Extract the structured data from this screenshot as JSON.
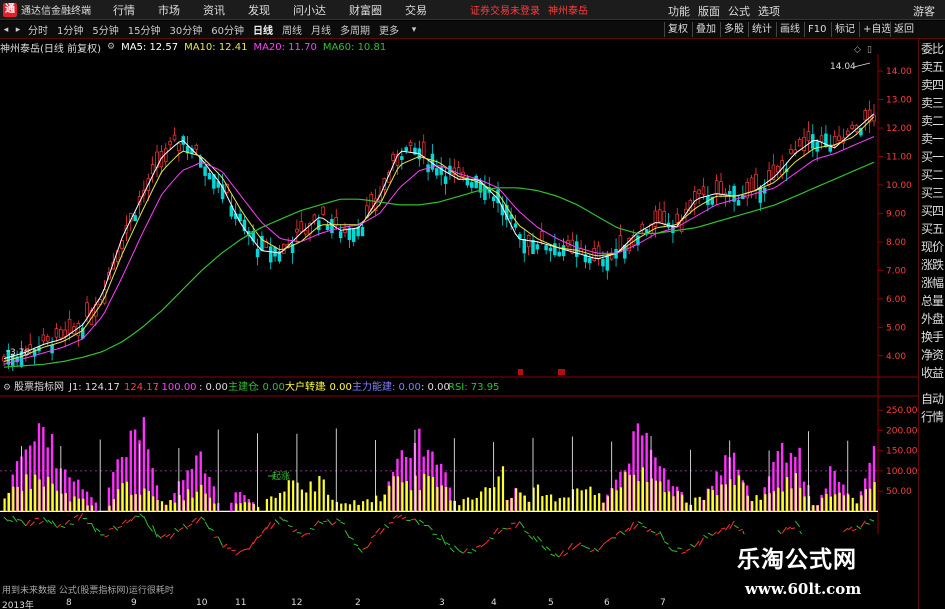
{
  "app": {
    "name": "通达信金融终端",
    "menus": [
      "行情",
      "市场",
      "资讯",
      "发现",
      "问小达",
      "财富圈",
      "交易"
    ],
    "alert": "证券交易未登录",
    "stock_name": "神州泰岳",
    "right_menus": [
      "功能",
      "版面",
      "公式",
      "选项"
    ],
    "guest": "游客"
  },
  "periods": [
    "分时",
    "1分钟",
    "5分钟",
    "15分钟",
    "30分钟",
    "60分钟",
    "日线",
    "周线",
    "月线",
    "多周期",
    "更多"
  ],
  "active_period": "日线",
  "toolbar_right": [
    "复权",
    "叠加",
    "多股",
    "统计",
    "画线",
    "F10",
    "标记",
    "+自选",
    "返回"
  ],
  "chart_header": {
    "title": "神州泰岳(日线 前复权)",
    "ma5": "MA5: 12.57",
    "ma10": "MA10: 12.41",
    "ma20": "MA20: 11.70",
    "ma60": "MA60: 10.81"
  },
  "price_axis": [
    "14.00",
    "13.00",
    "12.00",
    "11.00",
    "10.00",
    "9.00",
    "8.00",
    "7.00",
    "6.00",
    "5.00",
    "4.00"
  ],
  "price_marks": {
    "high": "14.04",
    "low": "3.78"
  },
  "indicator_header": {
    "name": "股票指标网",
    "j1": "J1: 124.17",
    "v2": "124.17",
    "v3": ": 100.00",
    "v4": ": 0.00",
    "zhujian_label": "主建仓",
    "zhujian_val": ": 0.00",
    "dahu_label": "大户转建",
    "dahu_val": ": 0.00",
    "zhuli_label": "主力能建",
    "zhuli_val": ": 0.00",
    "v5": ": 0.00",
    "rsi": "RSI: 73.95"
  },
  "indicator_axis": [
    "250.00",
    "200.00",
    "150.00",
    "100.00",
    "50.00"
  ],
  "indicator_marker": "起涨",
  "footnote": "用到未来数据  公式(股票指标网)运行很耗时",
  "x_axis": [
    "2013年",
    "8",
    "9",
    "10",
    "11",
    "12",
    "2",
    "3",
    "4",
    "5",
    "6",
    "7"
  ],
  "right_panel": [
    "委比",
    "卖五",
    "卖四",
    "卖三",
    "卖二",
    "卖一",
    "买一",
    "买二",
    "买三",
    "买四",
    "买五",
    "现价",
    "涨跌",
    "涨幅",
    "总量",
    "外盘",
    "换手",
    "净资",
    "收益",
    "自动",
    "行情"
  ],
  "watermark": {
    "cn": "乐淘公式网",
    "url": "www.60lt.com"
  },
  "colors": {
    "up": "#ff3b3b",
    "down": "#00d8d8",
    "ma5": "#ffffff",
    "ma10": "#e8e84a",
    "ma20": "#ff40ff",
    "ma60": "#30c030",
    "border": "#8b0000"
  },
  "chart_data": {
    "type": "candlestick",
    "ylim": [
      3.5,
      14.6
    ],
    "series_ma": [
      {
        "name": "MA5",
        "values": [
          3.9,
          4.1,
          4.4,
          4.6,
          5.1,
          6.2,
          8.2,
          9.6,
          11.0,
          11.6,
          10.9,
          10.0,
          8.6,
          7.7,
          7.6,
          8.3,
          8.9,
          8.4,
          8.5,
          9.6,
          11.2,
          11.1,
          10.6,
          10.2,
          10.2,
          9.5,
          8.1,
          8.0,
          7.8,
          7.6,
          7.4,
          7.6,
          8.3,
          8.7,
          8.5,
          9.5,
          9.7,
          9.6,
          9.8,
          10.3,
          11.1,
          11.6,
          11.3,
          11.9,
          12.5
        ]
      },
      {
        "name": "MA10",
        "values": [
          3.8,
          4.0,
          4.3,
          4.5,
          4.9,
          5.9,
          7.6,
          9.1,
          10.5,
          11.2,
          11.0,
          10.3,
          9.1,
          8.1,
          7.7,
          8.0,
          8.6,
          8.6,
          8.6,
          9.3,
          10.7,
          11.0,
          10.8,
          10.3,
          10.1,
          9.7,
          8.6,
          8.1,
          7.8,
          7.7,
          7.5,
          7.6,
          8.1,
          8.5,
          8.6,
          9.2,
          9.6,
          9.6,
          9.8,
          10.1,
          10.8,
          11.3,
          11.4,
          11.7,
          12.4
        ]
      },
      {
        "name": "MA20",
        "values": [
          3.7,
          3.9,
          4.1,
          4.3,
          4.6,
          5.4,
          6.8,
          8.3,
          9.7,
          10.5,
          10.8,
          10.5,
          9.6,
          8.7,
          8.1,
          8.0,
          8.3,
          8.5,
          8.6,
          9.0,
          9.9,
          10.5,
          10.7,
          10.4,
          10.2,
          9.9,
          9.1,
          8.5,
          8.1,
          7.8,
          7.6,
          7.6,
          7.9,
          8.3,
          8.5,
          8.9,
          9.3,
          9.5,
          9.7,
          9.9,
          10.4,
          10.9,
          11.1,
          11.4,
          11.7
        ]
      },
      {
        "name": "MA60",
        "values": [
          3.6,
          3.65,
          3.7,
          3.8,
          3.95,
          4.15,
          4.5,
          5.0,
          5.6,
          6.3,
          7.0,
          7.6,
          8.1,
          8.5,
          8.8,
          9.1,
          9.3,
          9.5,
          9.5,
          9.4,
          9.3,
          9.3,
          9.4,
          9.6,
          9.8,
          9.9,
          9.9,
          9.8,
          9.6,
          9.3,
          8.9,
          8.5,
          8.3,
          8.3,
          8.4,
          8.5,
          8.7,
          8.9,
          9.1,
          9.3,
          9.6,
          9.9,
          10.2,
          10.5,
          10.8
        ]
      }
    ],
    "indicator": {
      "ylim": [
        -120,
        270
      ],
      "magenta": [
        0,
        210,
        230,
        110,
        60,
        0,
        180,
        230,
        0,
        90,
        150,
        0,
        60,
        0,
        0,
        0,
        0,
        0,
        20,
        0,
        170,
        200,
        160,
        0,
        0,
        0,
        60,
        0,
        0,
        0,
        0,
        90,
        200,
        170,
        60,
        0,
        100,
        170,
        0,
        140,
        190,
        0,
        130,
        0,
        160
      ],
      "yellow": [
        40,
        80,
        90,
        40,
        30,
        0,
        70,
        60,
        20,
        40,
        70,
        0,
        30,
        10,
        70,
        60,
        80,
        20,
        30,
        40,
        90,
        80,
        70,
        20,
        50,
        100,
        110,
        60,
        30,
        70,
        40,
        70,
        110,
        80,
        50,
        30,
        60,
        80,
        40,
        70,
        90,
        20,
        50,
        30,
        70
      ],
      "oscillator": [
        -10,
        -30,
        -20,
        -40,
        -10,
        -60,
        -30,
        -10,
        -70,
        -40,
        -20,
        -80,
        -110,
        -50,
        -20,
        -60,
        -30,
        -20,
        -100,
        -50,
        -10,
        -30,
        -60,
        -100,
        -90,
        -50,
        -30,
        -70,
        -110,
        -80,
        -100,
        -60,
        -30,
        -50,
        -100,
        -80,
        -50,
        -30,
        -90,
        -60,
        -30,
        -90,
        -70,
        -40,
        -20
      ]
    }
  }
}
